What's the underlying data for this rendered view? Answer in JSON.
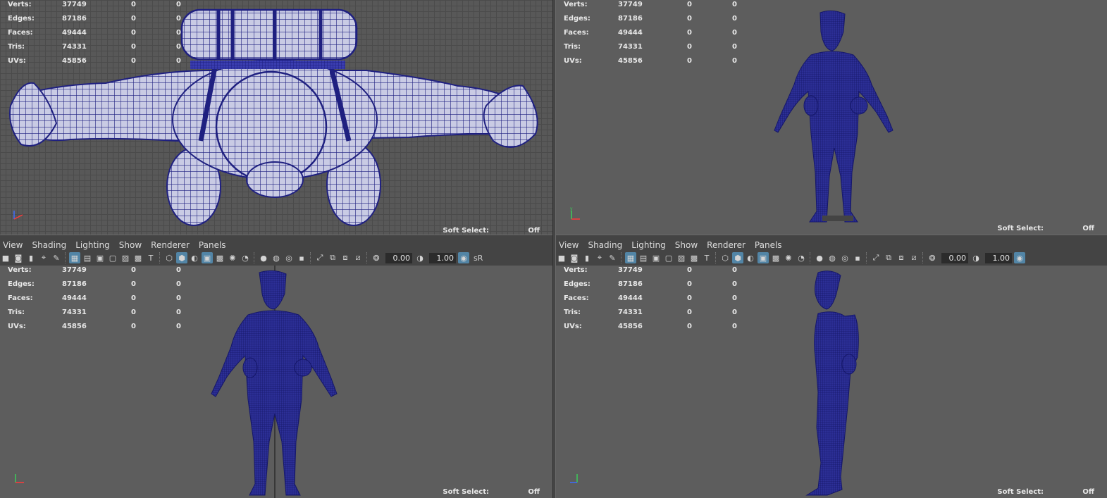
{
  "stats": {
    "labels": [
      "Verts:",
      "Edges:",
      "Faces:",
      "Tris:",
      "UVs:"
    ],
    "values": [
      "37749",
      "87186",
      "49444",
      "74331",
      "45856"
    ],
    "sel": "0",
    "sel2": "0"
  },
  "soft_select": {
    "label": "Soft Select:",
    "value": "Off"
  },
  "menu": [
    "View",
    "Shading",
    "Lighting",
    "Show",
    "Renderer",
    "Panels"
  ],
  "toolbar": {
    "field_a": "0.00",
    "field_b": "1.00",
    "srgb": "sR"
  },
  "axis": {
    "x": "x",
    "y": "y",
    "z": "z"
  },
  "colors": {
    "wire": "#1f2080",
    "viewport_bg": "#5d5d5d",
    "highlight": "#5285a6"
  },
  "icons": [
    "camera-icon",
    "bookmark-icon",
    "grid-icon",
    "film-gate-icon",
    "resolution-gate-icon",
    "wireframe-icon",
    "smooth-shade-icon",
    "textured-icon",
    "lights-icon",
    "shadows-icon",
    "xray-icon",
    "isolate-icon",
    "exposure-icon",
    "gamma-icon"
  ]
}
